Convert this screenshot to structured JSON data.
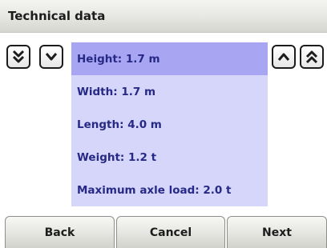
{
  "header": {
    "title": "Technical data"
  },
  "scroll_buttons": {
    "page_down_icon": "double-chevron-down",
    "line_down_icon": "chevron-down",
    "line_up_icon": "chevron-up",
    "page_up_icon": "double-chevron-up"
  },
  "list": {
    "selected_index": 0,
    "items": [
      {
        "label": "Height: 1.7 m"
      },
      {
        "label": "Width: 1.7 m"
      },
      {
        "label": "Length: 4.0 m"
      },
      {
        "label": "Weight: 1.2 t"
      },
      {
        "label": "Maximum axle load: 2.0 t"
      }
    ]
  },
  "footer": {
    "back_label": "Back",
    "cancel_label": "Cancel",
    "next_label": "Next"
  },
  "colors": {
    "list_background": "#d6d5fa",
    "selected_background": "#a8a5f2",
    "item_text": "#262a86"
  }
}
